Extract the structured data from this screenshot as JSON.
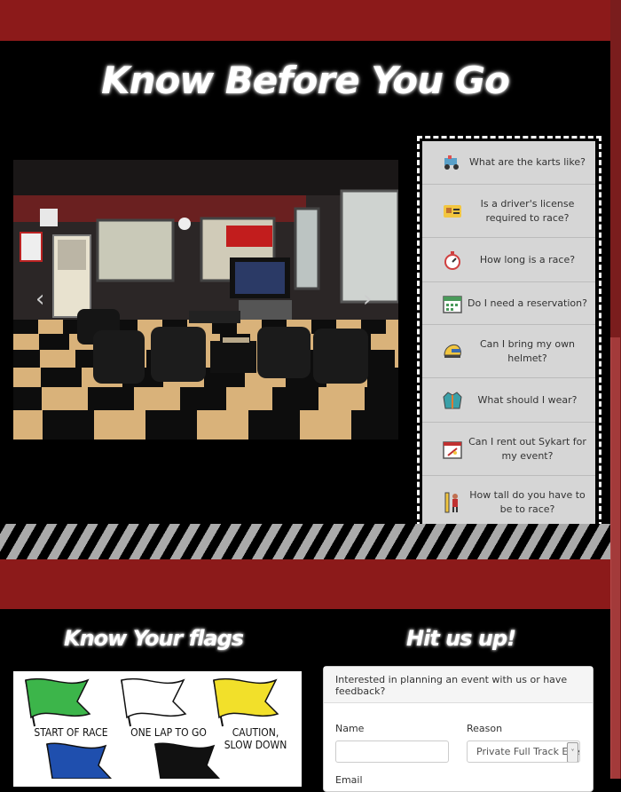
{
  "page": {
    "title": "Know Before You Go"
  },
  "carousel": {
    "prev_icon": "chevron-left-icon",
    "next_icon": "chevron-right-icon",
    "prev_glyph": "‹",
    "next_glyph": "›"
  },
  "faq": {
    "items": [
      {
        "label": "What are the karts like?",
        "icon": "kart-icon"
      },
      {
        "label": "Is a driver's license required to race?",
        "icon": "license-icon"
      },
      {
        "label": "How long is a race?",
        "icon": "stopwatch-icon"
      },
      {
        "label": "Do I need a reservation?",
        "icon": "calendar-icon"
      },
      {
        "label": "Can I bring my own helmet?",
        "icon": "helmet-icon"
      },
      {
        "label": "What should I wear?",
        "icon": "jacket-icon"
      },
      {
        "label": "Can I rent out Sykart for my event?",
        "icon": "event-calendar-icon"
      },
      {
        "label": "How tall do you have to be to race?",
        "icon": "height-icon"
      }
    ]
  },
  "flags": {
    "title": "Know Your flags",
    "items": [
      {
        "label": "START OF RACE",
        "color": "#3cb54a"
      },
      {
        "label": "ONE LAP TO GO",
        "color": "#ffffff"
      },
      {
        "label": "CAUTION, SLOW DOWN",
        "color": "#f2e02a"
      },
      {
        "label": "",
        "color": "#1f4fae"
      },
      {
        "label": "",
        "color": "#111111"
      }
    ]
  },
  "contact": {
    "title": "Hit us up!",
    "header": "Interested in planning an event with us or have feedback?",
    "name_label": "Name",
    "reason_label": "Reason",
    "reason_value": "Private Full Track Eve",
    "email_label": "Email"
  },
  "colors": {
    "brand_red": "#8c1a1a",
    "panel_gray": "#d6d6d6"
  }
}
